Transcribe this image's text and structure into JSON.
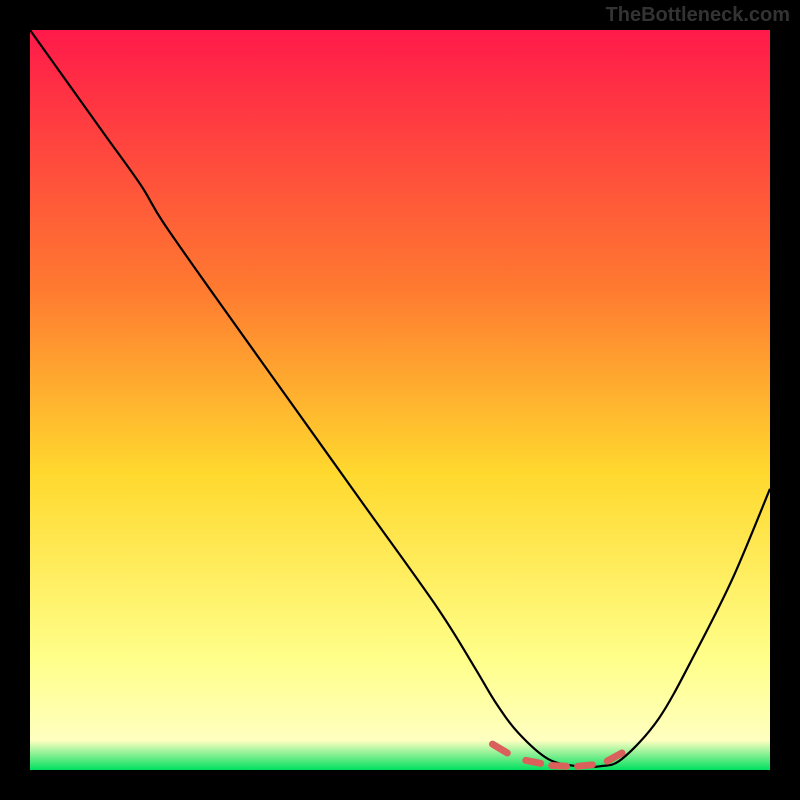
{
  "watermark": "TheBottleneck.com",
  "chart_data": {
    "type": "line",
    "title": "",
    "xlabel": "",
    "ylabel": "",
    "xlim": [
      0,
      100
    ],
    "ylim": [
      0,
      100
    ],
    "gradient_stops": [
      {
        "offset": 0,
        "color": "#ff1a4a"
      },
      {
        "offset": 35,
        "color": "#ff7a30"
      },
      {
        "offset": 60,
        "color": "#ffd92e"
      },
      {
        "offset": 85,
        "color": "#ffff8a"
      },
      {
        "offset": 96,
        "color": "#ffffc0"
      },
      {
        "offset": 100,
        "color": "#00e060"
      }
    ],
    "series": [
      {
        "name": "bottleneck-curve",
        "x": [
          0,
          5,
          10,
          15,
          18,
          25,
          35,
          45,
          55,
          60,
          63,
          66,
          70,
          74,
          77,
          80,
          85,
          90,
          95,
          100
        ],
        "y": [
          100,
          93,
          86,
          79,
          74,
          64,
          50,
          36,
          22,
          14,
          9,
          5,
          1.5,
          0.5,
          0.5,
          1.5,
          7,
          16,
          26,
          38
        ]
      }
    ],
    "markers": {
      "name": "highlight-dashes",
      "color": "#d9605b",
      "segments": [
        {
          "x1": 62.5,
          "y1": 3.5,
          "x2": 64.5,
          "y2": 2.3
        },
        {
          "x1": 67.0,
          "y1": 1.3,
          "x2": 69.0,
          "y2": 0.9
        },
        {
          "x1": 70.5,
          "y1": 0.6,
          "x2": 72.5,
          "y2": 0.5
        },
        {
          "x1": 74.0,
          "y1": 0.5,
          "x2": 76.0,
          "y2": 0.7
        },
        {
          "x1": 78.0,
          "y1": 1.2,
          "x2": 80.0,
          "y2": 2.3
        }
      ]
    },
    "frame_color": "#000000"
  }
}
